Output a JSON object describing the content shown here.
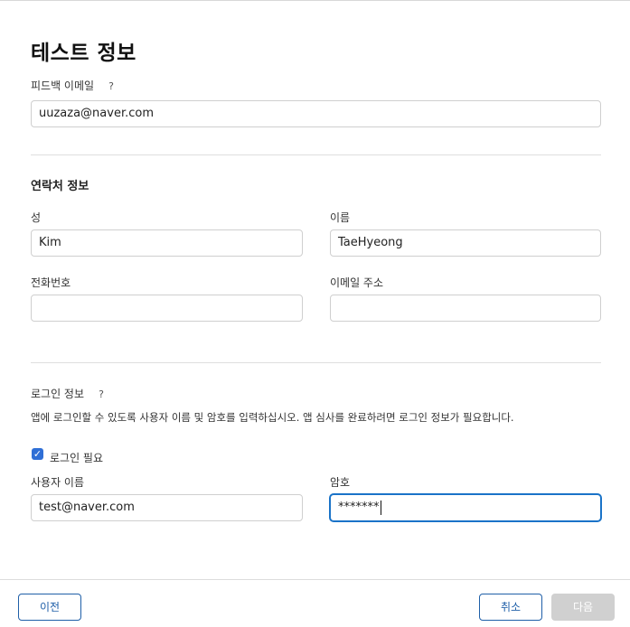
{
  "page": {
    "title": "테스트 정보"
  },
  "feedback": {
    "label": "피드백 이메일",
    "help": "?",
    "value": "uuzaza@naver.com"
  },
  "contact": {
    "section_title": "연락처 정보",
    "last_name_label": "성",
    "last_name_value": "Kim",
    "first_name_label": "이름",
    "first_name_value": "TaeHyeong",
    "phone_label": "전화번호",
    "phone_value": "",
    "email_label": "이메일 주소",
    "email_value": ""
  },
  "login": {
    "label": "로그인 정보",
    "help": "?",
    "description": "앱에 로그인할 수 있도록 사용자 이름 및 암호를 입력하십시오. 앱 심사를 완료하려면 로그인 정보가 필요합니다.",
    "required_label": "로그인 필요",
    "required_checked": true,
    "username_label": "사용자 이름",
    "username_value": "test@naver.com",
    "password_label": "암호",
    "password_value": "*******"
  },
  "footer": {
    "back_label": "이전",
    "cancel_label": "취소",
    "next_label": "다음"
  },
  "colors": {
    "accent": "#1f5fa8",
    "focus": "#1a73c8",
    "checkbox": "#2f6fd6",
    "disabled": "#d0d0d0"
  }
}
